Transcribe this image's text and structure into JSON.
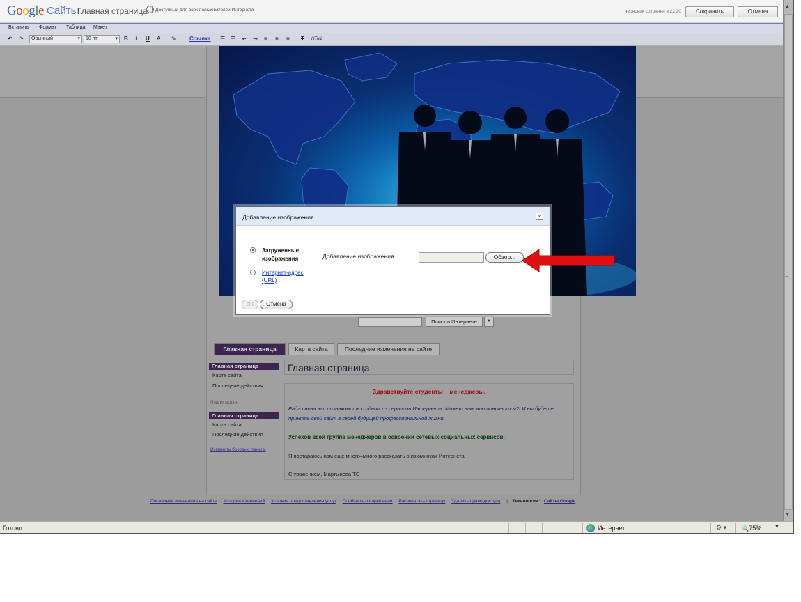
{
  "header": {
    "logo_google": "Google",
    "logo_sites": "Сайты",
    "page_title": "Главная страница",
    "access_note": "Доступный для всех пользователей Интернета",
    "draft_status": "черновик сохранен в 22:20",
    "save_label": "Сохранить",
    "cancel_label": "Отмена"
  },
  "menubar": {
    "items": [
      "Вставить",
      "Формат",
      "Таблица",
      "Макет"
    ]
  },
  "toolbar": {
    "style_select": "Обычный",
    "size_select": "10 пт",
    "bold": "B",
    "italic": "I",
    "underline": "U",
    "text_color": "A",
    "link_label": "Ссылка",
    "html_label": "HTML"
  },
  "search": {
    "button_label": "Поиск в Интернете"
  },
  "tabs": [
    {
      "label": "Главная страница"
    },
    {
      "label": "Карта сайта"
    },
    {
      "label": "Последние изменения на сайте"
    }
  ],
  "sidebar": {
    "group1_head": "Главная страница",
    "group1_items": [
      "Карта сайта",
      "Последние действия"
    ],
    "nav_label": "Навигация",
    "group2_head": "Главная страница",
    "group2_items": [
      "Карта сайта",
      "Последние действия"
    ],
    "edit_link": "Изменить боковую панель"
  },
  "content": {
    "title": "Главная страница",
    "greeting": "Здравствуйте студенты – менеджеры.",
    "intro": "Рада снова вас познакомить с одним из сервисов Интернета. Может вам это понравится?! И вы будете принять свой сайт в своей будущей профессиональной жизни.",
    "success": "Успехов всей группе менеджеров в освоении сетевых социальных сервисов.",
    "promise": "Я постараюсь вам еще много–много рассказать о изюминках Интернета.",
    "signature": "С уважением, Мартынова ТС"
  },
  "footer": {
    "links": [
      "Последние изменения на сайте",
      "История изменений",
      "Условия предоставления услуг",
      "Сообщить о нарушении",
      "Распечатать страницу",
      "Удалить право доступа"
    ],
    "separator": "|",
    "tech_label": "Технологии:",
    "tech_link": "Сайты Google"
  },
  "dialog": {
    "title": "Добавление изображения",
    "option_uploaded": "Загруженные изображения",
    "option_url": "Интернет-адрес (URL)",
    "field_label": "Добавление изображения",
    "browse_label": "Обзор...",
    "ok_label": "OK",
    "cancel_label": "Отмена"
  },
  "statusbar": {
    "status": "Готово",
    "zone": "Интернет",
    "zoom": "75%"
  },
  "colors": {
    "accent_purple": "#3d2550",
    "arrow_red": "#e11010",
    "dialog_header": "#dfe9f7"
  }
}
